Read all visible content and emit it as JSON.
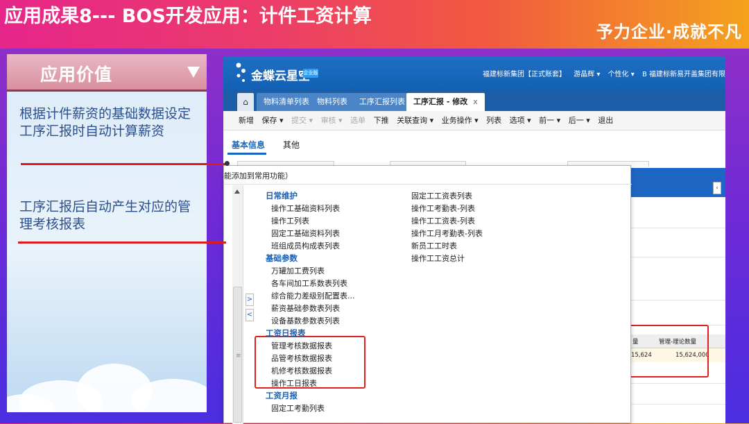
{
  "slide": {
    "title": "应用成果8--- BOS开发应用：计件工资计算",
    "slogan": "予力企业·成就不凡"
  },
  "panel": {
    "header": "应用价值",
    "points": [
      "根据计件薪资的基础数据设定工序汇报时自动计算薪资",
      "工序汇报后自动产生对应的管理考核报表"
    ]
  },
  "erp": {
    "logo": "金蝶云星空",
    "logo_badge": "企业版",
    "topbar": [
      "福建标新集团【正式账套】",
      "游晶辉 ▾",
      "个性化 ▾",
      "B 福建标新易开盖集团有限"
    ],
    "home_icon": "home-icon",
    "tabs": [
      {
        "label": "物料清单列表"
      },
      {
        "label": "物料列表"
      },
      {
        "label": "工序汇报列表"
      },
      {
        "label": "工序汇报 - 修改",
        "close": "x"
      }
    ],
    "toolbar": [
      "新增",
      "保存 ▾",
      "提交 ▾",
      "审核 ▾",
      "选单",
      "下推",
      "关联查询 ▾",
      "业务操作 ▾",
      "列表",
      "选项 ▾",
      "前一 ▾",
      "后一 ▾",
      "退出"
    ],
    "subtabs": [
      "基本信息",
      "其他"
    ],
    "grid": {
      "header": [
        "量",
        "管理-理论数量"
      ],
      "row": [
        "15,624",
        "15,624,000"
      ]
    },
    "blueband_tag": "‹"
  },
  "dropdown": {
    "hint": "能添加到常用功能）",
    "side_buttons": [
      ">",
      "<"
    ],
    "scroll_grip": "≡",
    "col1": [
      {
        "type": "cat",
        "text": "日常维护"
      },
      {
        "type": "item",
        "text": "操作工基础资料列表"
      },
      {
        "type": "item",
        "text": "操作工列表"
      },
      {
        "type": "item",
        "text": "固定工基础资料列表"
      },
      {
        "type": "item",
        "text": "班组成员构成表列表"
      },
      {
        "type": "cat",
        "text": "基础参数"
      },
      {
        "type": "item",
        "text": "万罐加工费列表"
      },
      {
        "type": "item",
        "text": "各车间加工系数表列表"
      },
      {
        "type": "item",
        "text": "综合能力差级别配置表..."
      },
      {
        "type": "item",
        "text": "薪资基础参数表列表"
      },
      {
        "type": "item",
        "text": "设备基数参数表列表"
      },
      {
        "type": "cat",
        "text": "工资日报表"
      },
      {
        "type": "item",
        "text": "管理考核数据报表"
      },
      {
        "type": "item",
        "text": "品管考核数据报表"
      },
      {
        "type": "item",
        "text": "机修考核数据报表"
      },
      {
        "type": "item",
        "text": "操作工日报表"
      },
      {
        "type": "cat",
        "text": "工资月报"
      },
      {
        "type": "item",
        "text": "固定工考勤列表"
      }
    ],
    "col2": [
      {
        "type": "item",
        "text": "固定工工资表列表"
      },
      {
        "type": "item",
        "text": "操作工考勤表-列表"
      },
      {
        "type": "item",
        "text": "操作工工资表-列表"
      },
      {
        "type": "item",
        "text": "操作工月考勤表-列表"
      },
      {
        "type": "item",
        "text": "新员工工时表"
      },
      {
        "type": "item",
        "text": "操作工工资总计"
      }
    ]
  },
  "colors": {
    "highlight": "#e0201d",
    "category": "#1e5fb0",
    "topbar": "#1e6fc4"
  }
}
